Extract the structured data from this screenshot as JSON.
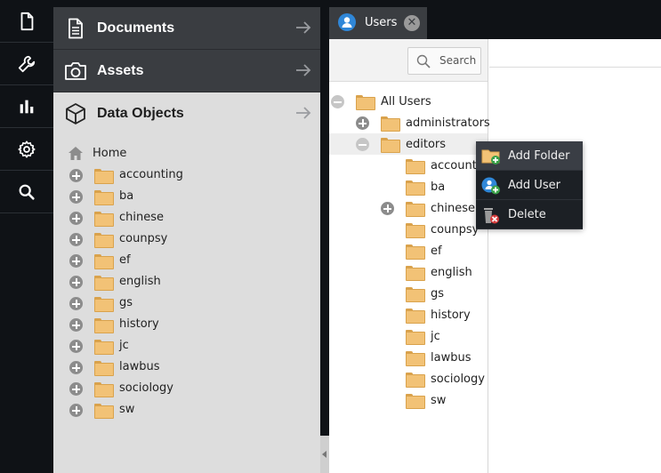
{
  "rail": {
    "items": [
      {
        "name": "document-icon"
      },
      {
        "name": "wrench-icon"
      },
      {
        "name": "bar-chart-icon"
      },
      {
        "name": "gear-icon"
      },
      {
        "name": "search-icon"
      }
    ]
  },
  "accordion": {
    "documents_label": "Documents",
    "assets_label": "Assets",
    "data_objects_label": "Data Objects"
  },
  "object_tree": {
    "root_label": "Home",
    "items": [
      "accounting",
      "ba",
      "chinese",
      "counpsy",
      "ef",
      "english",
      "gs",
      "history",
      "jc",
      "lawbus",
      "sociology",
      "sw"
    ]
  },
  "tab": {
    "label": "Users",
    "close_glyph": "✕"
  },
  "users_panel": {
    "search_label": "Search",
    "root_label": "All Users",
    "groups": [
      {
        "label": "administrators",
        "expanded": false
      },
      {
        "label": "editors",
        "expanded": true
      }
    ],
    "editors_children": [
      {
        "label": "accounting",
        "expandable": false
      },
      {
        "label": "ba",
        "expandable": false
      },
      {
        "label": "chinese",
        "expandable": true
      },
      {
        "label": "counpsy",
        "expandable": false
      },
      {
        "label": "ef",
        "expandable": false
      },
      {
        "label": "english",
        "expandable": false
      },
      {
        "label": "gs",
        "expandable": false
      },
      {
        "label": "history",
        "expandable": false
      },
      {
        "label": "jc",
        "expandable": false
      },
      {
        "label": "lawbus",
        "expandable": false
      },
      {
        "label": "sociology",
        "expandable": false
      },
      {
        "label": "sw",
        "expandable": false
      }
    ]
  },
  "context_menu": {
    "items": [
      {
        "label": "Add Folder",
        "icon": "add-folder-icon"
      },
      {
        "label": "Add User",
        "icon": "add-user-icon"
      },
      {
        "label": "Delete",
        "icon": "delete-icon"
      }
    ]
  },
  "colors": {
    "rail_bg": "#0f1216",
    "accordion_dark": "#3a3d41",
    "panel_bg": "#dddddd",
    "folder": "#f2c276",
    "accent_blue": "#2f87d8"
  }
}
